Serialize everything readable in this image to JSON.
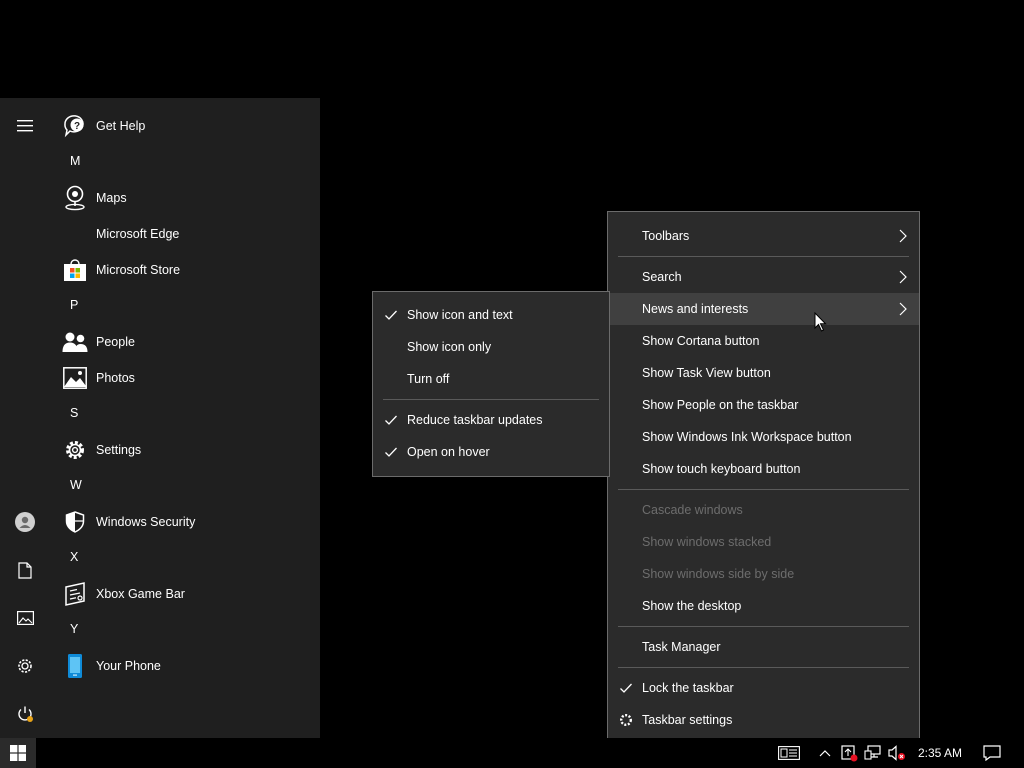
{
  "start_menu": {
    "rail": {
      "icons": [
        "hamburger-menu-icon",
        "user-account-icon",
        "documents-icon",
        "pictures-icon",
        "settings-icon",
        "power-icon"
      ]
    },
    "apps": [
      {
        "kind": "app",
        "label": "Get Help",
        "icon": "get-help-icon"
      },
      {
        "kind": "letter",
        "label": "M"
      },
      {
        "kind": "app",
        "label": "Maps",
        "icon": "maps-icon"
      },
      {
        "kind": "app",
        "label": "Microsoft Edge",
        "icon": ""
      },
      {
        "kind": "app",
        "label": "Microsoft Store",
        "icon": "microsoft-store-icon"
      },
      {
        "kind": "letter",
        "label": "P"
      },
      {
        "kind": "app",
        "label": "People",
        "icon": "people-icon"
      },
      {
        "kind": "app",
        "label": "Photos",
        "icon": "photos-icon"
      },
      {
        "kind": "letter",
        "label": "S"
      },
      {
        "kind": "app",
        "label": "Settings",
        "icon": "settings-icon"
      },
      {
        "kind": "letter",
        "label": "W"
      },
      {
        "kind": "app",
        "label": "Windows Security",
        "icon": "windows-security-icon"
      },
      {
        "kind": "letter",
        "label": "X"
      },
      {
        "kind": "app",
        "label": "Xbox Game Bar",
        "icon": "xbox-game-bar-icon"
      },
      {
        "kind": "letter",
        "label": "Y"
      },
      {
        "kind": "app",
        "label": "Your Phone",
        "icon": "your-phone-icon"
      }
    ]
  },
  "taskbar_menu": {
    "items": [
      {
        "label": "Toolbars",
        "submenu": true
      },
      {
        "label": "Search",
        "submenu": true
      },
      {
        "label": "News and interests",
        "submenu": true,
        "highlighted": true
      },
      {
        "label": "Show Cortana button"
      },
      {
        "label": "Show Task View button"
      },
      {
        "label": "Show People on the taskbar"
      },
      {
        "label": "Show Windows Ink Workspace button"
      },
      {
        "label": "Show touch keyboard button"
      },
      {
        "label": "Cascade windows",
        "disabled": true
      },
      {
        "label": "Show windows stacked",
        "disabled": true
      },
      {
        "label": "Show windows side by side",
        "disabled": true
      },
      {
        "label": "Show the desktop"
      },
      {
        "label": "Task Manager"
      },
      {
        "label": "Lock the taskbar",
        "checked": true
      },
      {
        "label": "Taskbar settings",
        "icon": "gear-icon"
      }
    ]
  },
  "news_submenu": {
    "items": [
      {
        "label": "Show icon and text",
        "checked": true
      },
      {
        "label": "Show icon only"
      },
      {
        "label": "Turn off"
      },
      {
        "label": "Reduce taskbar updates",
        "checked": true
      },
      {
        "label": "Open on hover",
        "checked": true
      }
    ]
  },
  "taskbar": {
    "clock": "2:35 AM",
    "tray_icons": [
      "news-widget-icon",
      "show-hidden-icons-chevron-icon",
      "security-alert-icon",
      "network-icon",
      "volume-muted-icon",
      "action-center-icon"
    ]
  },
  "colors": {
    "menu_bg": "#2b2b2b",
    "menu_highlight": "#404040",
    "start_bg": "#1f1f1f",
    "disabled_text": "#6d6d6d"
  }
}
